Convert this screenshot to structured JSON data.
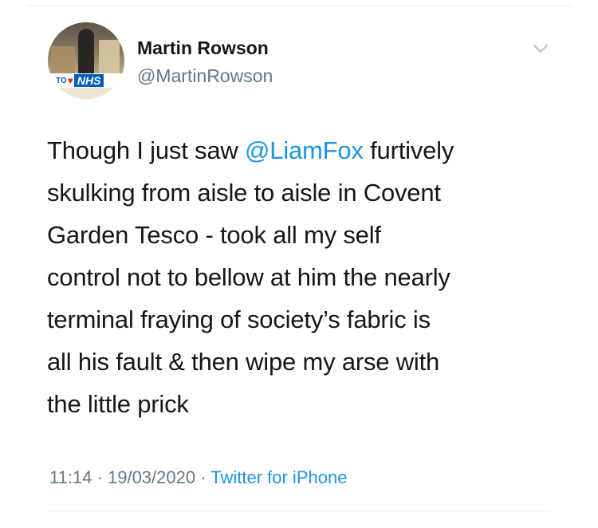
{
  "tweet": {
    "author": {
      "name": "Martin Rowson",
      "handle": "@MartinRowson",
      "avatar_badge": {
        "prefix": "TO",
        "label": "NHS"
      }
    },
    "text": {
      "line1_before": "Though I just saw ",
      "mention": "@LiamFox",
      "line1_after": " furtively",
      "line2": "skulking from aisle to aisle in Covent",
      "line3": "Garden Tesco - took all my self",
      "line4": "control not to bellow at him the nearly",
      "line5": "terminal fraying of society’s fabric is",
      "line6": "all his fault & then wipe my arse with",
      "line7": "the little prick"
    },
    "meta": {
      "time": "11:14",
      "separator": " · ",
      "date": "19/03/2020",
      "source": "Twitter for iPhone"
    },
    "menu_icon": "chevron-down-icon"
  },
  "colors": {
    "text": "#14171a",
    "secondary": "#657786",
    "link": "#1b95e0",
    "divider": "#e6ecf0",
    "nhs_blue": "#005eb8",
    "heart_red": "#e0262f"
  }
}
